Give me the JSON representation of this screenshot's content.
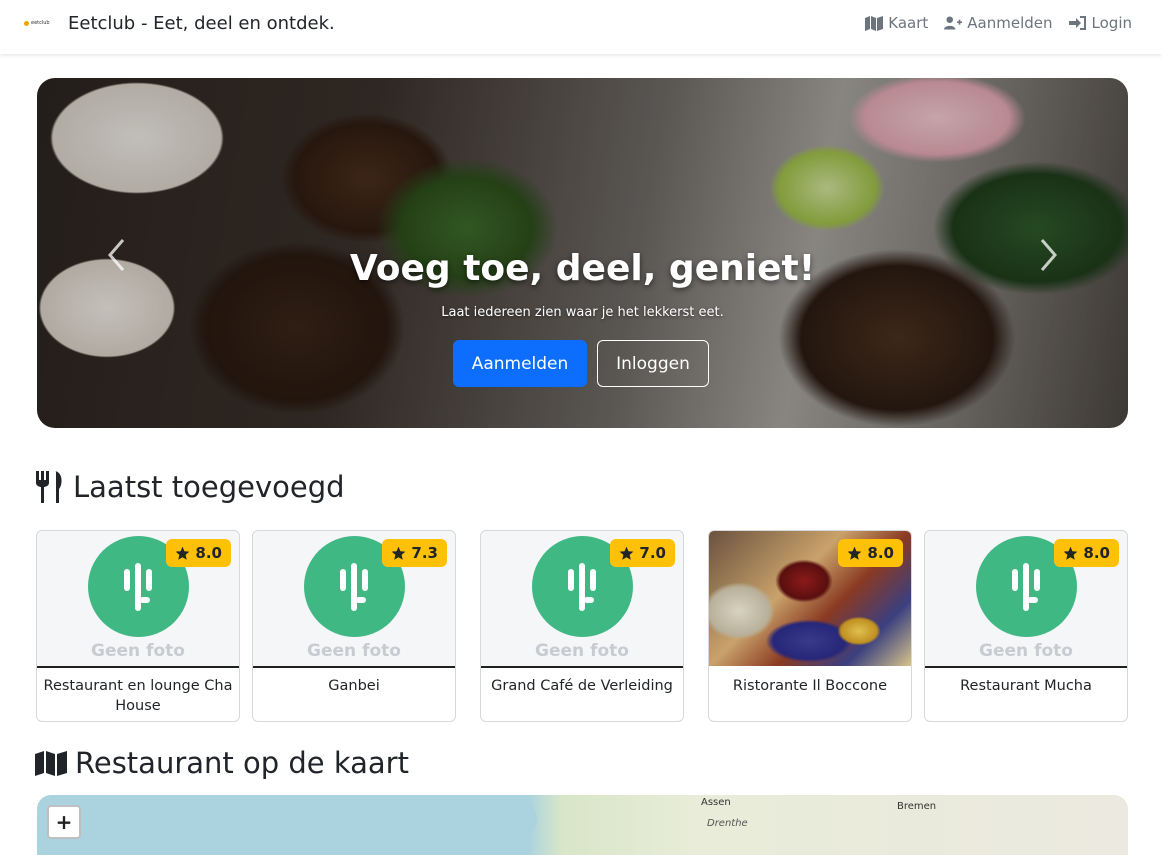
{
  "navbar": {
    "logo_text": "eetclub",
    "title": "Eetclub - Eet, deel en ontdek.",
    "links": [
      {
        "label": "Kaart",
        "icon": "map-icon"
      },
      {
        "label": "Aanmelden",
        "icon": "user-plus-icon"
      },
      {
        "label": "Login",
        "icon": "sign-in-icon"
      }
    ]
  },
  "hero": {
    "title": "Voeg toe, deel, geniet!",
    "subtitle": "Laat iedereen zien waar je het lekkerst eet.",
    "primary_button": "Aanmelden",
    "secondary_button": "Inloggen"
  },
  "latest": {
    "heading": "Laatst toegevoegd",
    "no_photo": "Geen foto",
    "cards": [
      {
        "name": "Restaurant en lounge Cha House",
        "rating": "8.0",
        "has_photo": false
      },
      {
        "name": "Ganbei",
        "rating": "7.3",
        "has_photo": false
      },
      {
        "name": "Grand Café de Verleiding",
        "rating": "7.0",
        "has_photo": false
      },
      {
        "name": "Ristorante Il Boccone",
        "rating": "8.0",
        "has_photo": true
      },
      {
        "name": "Restaurant Mucha",
        "rating": "8.0",
        "has_photo": false
      }
    ]
  },
  "map_section": {
    "heading": "Restaurant op de kaart",
    "zoom_in": "+",
    "labels": [
      "Assen",
      "Drenthe",
      "Bremen"
    ]
  },
  "colors": {
    "primary": "#0d6efd",
    "rating_badge": "#ffc107",
    "logo_green": "#40b883"
  }
}
